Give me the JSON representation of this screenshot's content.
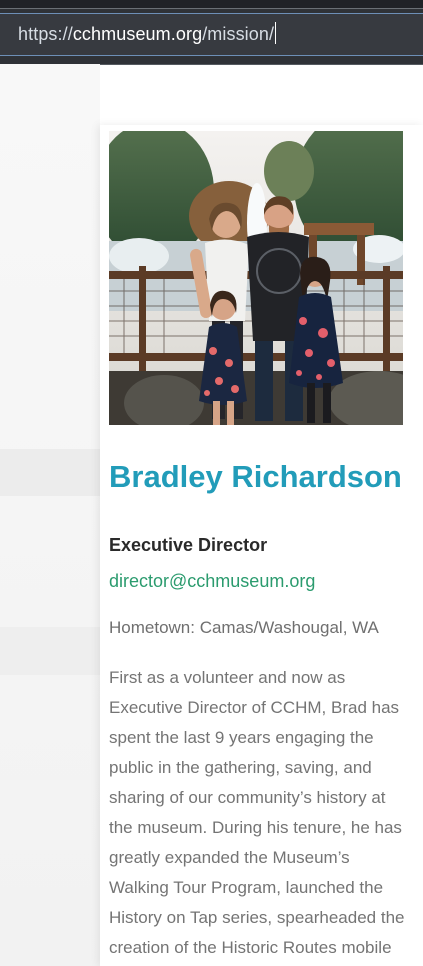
{
  "browser": {
    "url_scheme": "https://",
    "url_host": "cchmuseum.org",
    "url_path": "/mission/"
  },
  "profile": {
    "name": "Bradley Richardson",
    "title": "Executive Director",
    "email": "director@cchmuseum.org",
    "hometown": "Hometown: Camas/Washougal, WA",
    "bio": "First as a volunteer and now as Executive Director of CCHM, Brad has spent the last 9 years engaging the public in the gathering, saving, and sharing of our community’s history at the museum. During his tenure, he has greatly expanded the Museum’s Walking Tour Program, launched the History on Tap series, spearheaded the creation of the Historic Routes mobile"
  },
  "colors": {
    "accent": "#229cb9",
    "link": "#2b9b6e",
    "text": "#747474"
  }
}
